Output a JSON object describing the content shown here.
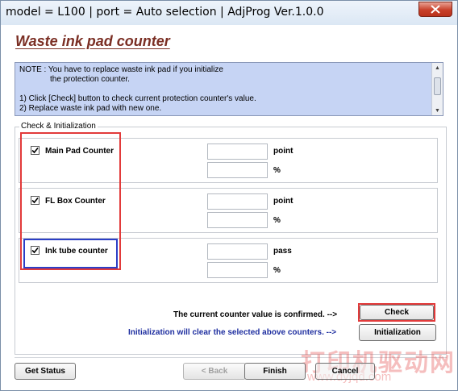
{
  "window": {
    "title": "model = L100 | port = Auto selection | AdjProg Ver.1.0.0"
  },
  "heading": "Waste ink pad counter",
  "note": {
    "line1": "NOTE : You have to replace waste ink pad if you initialize",
    "line2": "the protection counter.",
    "line3": "1) Click [Check] button to check current protection counter's value.",
    "line4": "2) Replace waste ink pad with new one."
  },
  "group": {
    "label": "Check & Initialization",
    "counters": [
      {
        "label": "Main Pad Counter",
        "checked": true,
        "value": "",
        "unit": "point",
        "percent": "",
        "percent_unit": "%"
      },
      {
        "label": "FL Box Counter",
        "checked": true,
        "value": "",
        "unit": "point",
        "percent": "",
        "percent_unit": "%"
      },
      {
        "label": "Ink tube counter",
        "checked": true,
        "value": "",
        "unit": "pass",
        "percent": "",
        "percent_unit": "%"
      }
    ]
  },
  "actions": {
    "confirm_text": "The current counter value is confirmed. -->",
    "check_label": "Check",
    "init_text": "Initialization will clear the selected above counters. -->",
    "init_label": "Initialization"
  },
  "footer": {
    "get_status": "Get Status",
    "back": "< Back",
    "finish": "Finish",
    "cancel": "Cancel"
  },
  "watermark": {
    "text": "打印机驱动网",
    "url": "www.dyjqd.com"
  },
  "colors": {
    "heading": "#7b2f24",
    "note_bg": "#c6d4f4",
    "init_text": "#1f2fa0",
    "highlight_red": "#e23a3a",
    "highlight_blue": "#2c3fc7"
  }
}
